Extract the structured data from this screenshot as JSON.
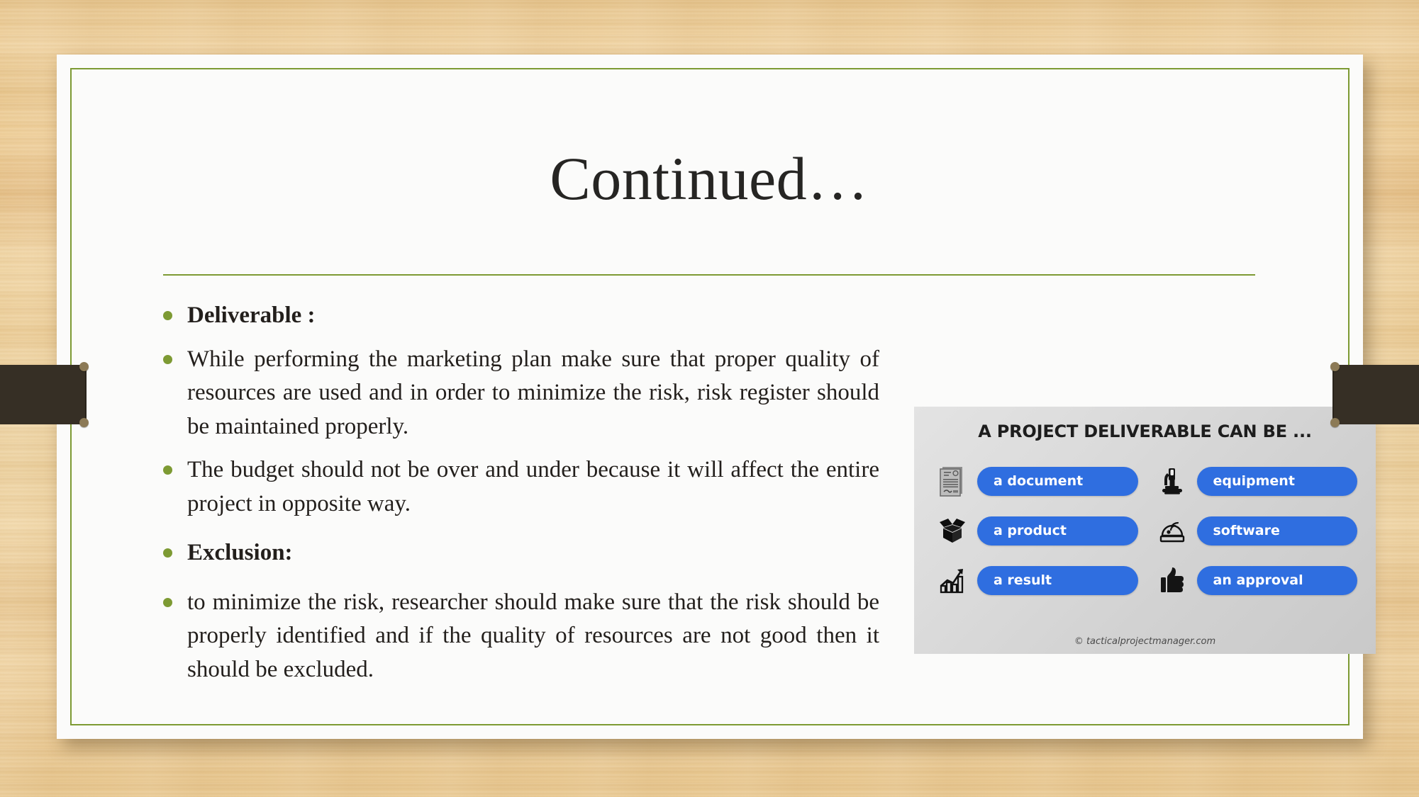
{
  "slide": {
    "title": "Continued…",
    "accent_green": "#7d9a33",
    "card_background": "#fbfbfa",
    "ribbon_color": "#362f25",
    "backdrop": "wood-texture-tan"
  },
  "body": {
    "bullets": [
      {
        "text": "Deliverable :",
        "style": "heading"
      },
      {
        "text": "While performing the marketing plan make sure that proper quality of resources are used and in order to minimize the risk, risk register should be maintained properly.",
        "style": "paragraph"
      },
      {
        "text": "The budget should not be over and under because it will affect the entire project in opposite way.",
        "style": "paragraph"
      },
      {
        "text": "Exclusion:",
        "style": "heading"
      },
      {
        "text": "to minimize the risk, researcher should make sure that the risk should be properly identified and if the quality of resources are not good then it should be excluded.",
        "style": "paragraph"
      }
    ]
  },
  "infographic": {
    "title": "A PROJECT DELIVERABLE CAN BE ...",
    "credit": "© tacticalprojectmanager.com",
    "pill_color": "#2f6ee0",
    "items": [
      {
        "label": "a document",
        "icon": "certificate-icon"
      },
      {
        "label": "equipment",
        "icon": "microscope-icon"
      },
      {
        "label": "a product",
        "icon": "open-box-icon"
      },
      {
        "label": "software",
        "icon": "disc-icon"
      },
      {
        "label": "a result",
        "icon": "bar-chart-growth-icon"
      },
      {
        "label": "an approval",
        "icon": "thumbs-up-icon"
      }
    ]
  }
}
